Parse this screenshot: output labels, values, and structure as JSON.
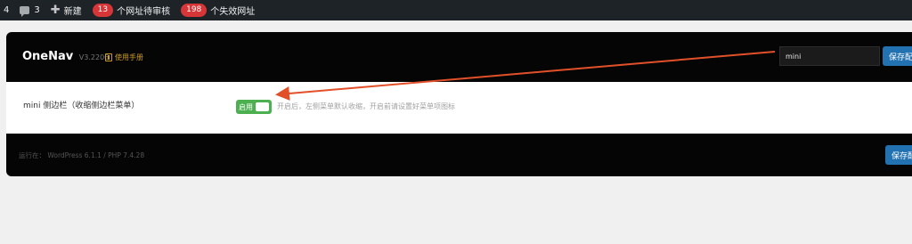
{
  "admin_bar": {
    "updates_count": "4",
    "comments_count": "3",
    "new_label": "新建",
    "pending_count": "13",
    "pending_label": "个网址待审核",
    "invalid_count": "198",
    "invalid_label": "个失效网址"
  },
  "header": {
    "brand": "OneNav",
    "version": "V3.2206",
    "manual_label": "使用手册",
    "search_value": "mini",
    "save_label": "保存配"
  },
  "setting": {
    "label": "mini 侧边栏（收缩侧边栏菜单）",
    "switch_text": "启用",
    "switch_on": true,
    "description": "开启后，左侧菜单默认收缩，开启前请设置好菜单项图标"
  },
  "footer": {
    "run_info": "运行在： WordPress 6.1.1 / PHP 7.4.28",
    "save_label": "保存配"
  },
  "colors": {
    "accent": "#2271b1",
    "switch_on": "#4caf50",
    "annotation": "#e2502a",
    "badge": "#d63638"
  }
}
